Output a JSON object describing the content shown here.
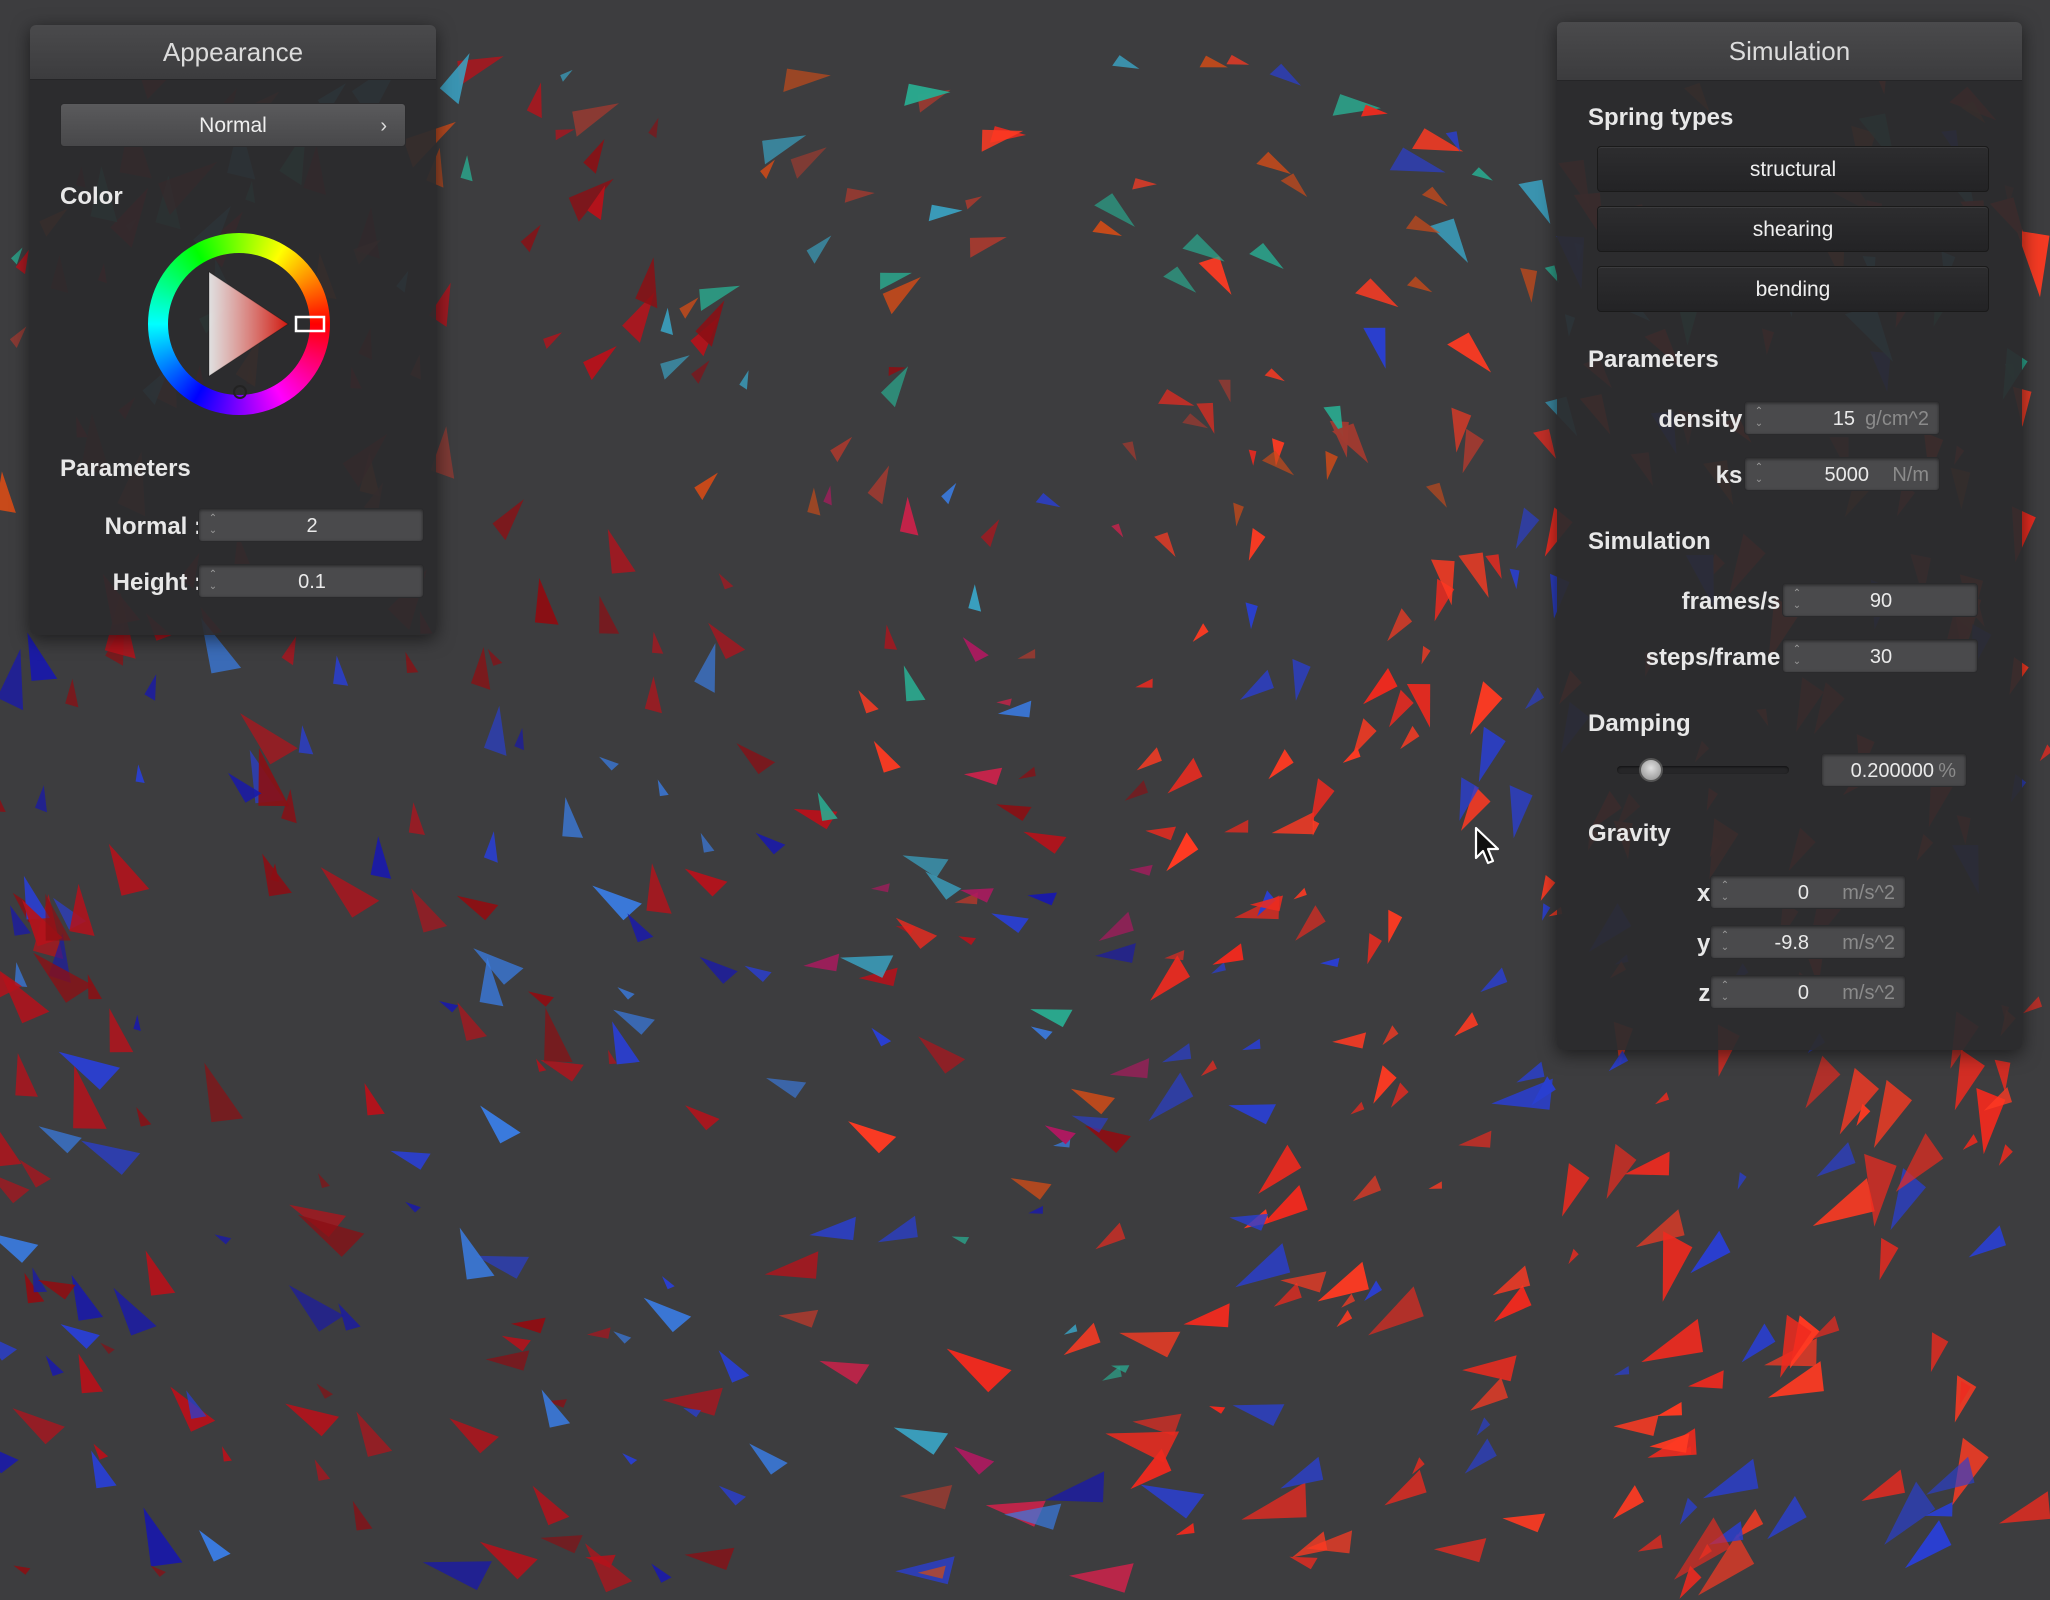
{
  "appearance": {
    "title": "Appearance",
    "mode_select": {
      "value": "Normal",
      "chevron": "chevron-right-icon"
    },
    "color": {
      "label": "Color",
      "selected_color": "#d03020"
    },
    "parameters": {
      "label": "Parameters",
      "fields": [
        {
          "label": "Normal :",
          "value": "2"
        },
        {
          "label": "Height :",
          "value": "0.1"
        }
      ]
    }
  },
  "simulation": {
    "title": "Simulation",
    "spring_types": {
      "label": "Spring types",
      "buttons": [
        "structural",
        "shearing",
        "bending"
      ]
    },
    "parameters": {
      "label": "Parameters",
      "density": {
        "label": "density :",
        "value": "15",
        "unit": "g/cm^2"
      },
      "ks": {
        "label": "ks :",
        "value": "5000",
        "unit": "N/m"
      }
    },
    "sim": {
      "label": "Simulation",
      "frames_per_s": {
        "label": "frames/s :",
        "value": "90"
      },
      "steps_per_frame": {
        "label": "steps/frame :",
        "value": "30"
      }
    },
    "damping": {
      "label": "Damping",
      "value": "0.200000",
      "unit": "%",
      "slider_fraction": 0.2
    },
    "gravity": {
      "label": "Gravity",
      "x": {
        "label": "x :",
        "value": "0",
        "unit": "m/s^2"
      },
      "y": {
        "label": "y :",
        "value": "-9.8",
        "unit": "m/s^2"
      },
      "z": {
        "label": "z :",
        "value": "0",
        "unit": "m/s^2"
      }
    }
  },
  "scene": {
    "background": "#3d3d3f",
    "palette": [
      "#8b0f14",
      "#b5121b",
      "#ee2a1f",
      "#ff3a22",
      "#c84a1a",
      "#d0214b",
      "#b01860",
      "#3a7be0",
      "#2a3fd0",
      "#1a1aa8",
      "#3aa0c0",
      "#2aa88e",
      "#a03a30"
    ]
  }
}
